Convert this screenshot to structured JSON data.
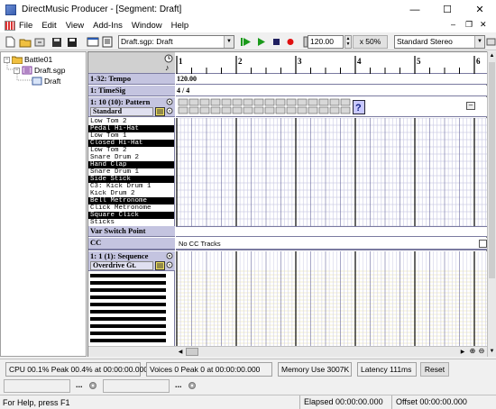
{
  "window": {
    "title": "DirectMusic Producer - [Segment: Draft]"
  },
  "menu": [
    "File",
    "Edit",
    "View",
    "Add-Ins",
    "Window",
    "Help"
  ],
  "toolbar": {
    "segment_combo": "Draft.sgp: Draft",
    "tempo_value": "120.00",
    "zoom_label": "x 50%",
    "synth_combo": "Standard Stereo"
  },
  "tree": {
    "root": "Battle01",
    "child": "Draft.sgp",
    "leaf": "Draft"
  },
  "tracks": {
    "tempo_label": "1-32: Tempo",
    "tempo_value": "120.00",
    "timesig_label": "1: TimeSig",
    "timesig_value": "4 / 4",
    "pattern_label": "1: 10 (10): Pattern",
    "pattern_style": "Standard",
    "varswitch_label": "Var Switch Point",
    "cc_label": "CC",
    "cc_text": "No CC Tracks",
    "sequence_label": "1: 1 (1): Sequence",
    "sequence_instrument": "Overdrive Gt."
  },
  "measures": [
    "1",
    "2",
    "3",
    "4",
    "5",
    "6"
  ],
  "drums": [
    {
      "name": "Low Tom 2",
      "dark": false
    },
    {
      "name": "Pedal Hi-Hat",
      "dark": true
    },
    {
      "name": "Low Tom 1",
      "dark": false
    },
    {
      "name": "Closed Hi-Hat",
      "dark": true
    },
    {
      "name": "Low Tom 2",
      "dark": false
    },
    {
      "name": "Snare Drum 2",
      "dark": false
    },
    {
      "name": "Hand Clap",
      "dark": true
    },
    {
      "name": "Snare Drum 1",
      "dark": false
    },
    {
      "name": "Side Stick",
      "dark": true
    },
    {
      "name": "C3: Kick Drum 1",
      "dark": false
    },
    {
      "name": "Kick Drum 2",
      "dark": false
    },
    {
      "name": "Bell Metronome",
      "dark": true
    },
    {
      "name": "Click Metronome",
      "dark": false
    },
    {
      "name": "Square Click",
      "dark": true
    },
    {
      "name": "Sticks",
      "dark": false
    }
  ],
  "status": {
    "cpu": "CPU 00.1% Peak 00.4% at 00:00:00.000",
    "voices": "Voices 0 Peak 0 at 00:00:00.000",
    "memory": "Memory Use 3007K",
    "latency": "Latency 111ms",
    "reset": "Reset",
    "help": "For Help, press F1",
    "elapsed": "Elapsed 00:00:00.000",
    "offset": "Offset 00:00:00.000"
  },
  "colors": {
    "header": "#c4c4e0",
    "grid_line": "#b8b8d8",
    "accent_play": "#1a9a1a",
    "record": "#e01010"
  }
}
